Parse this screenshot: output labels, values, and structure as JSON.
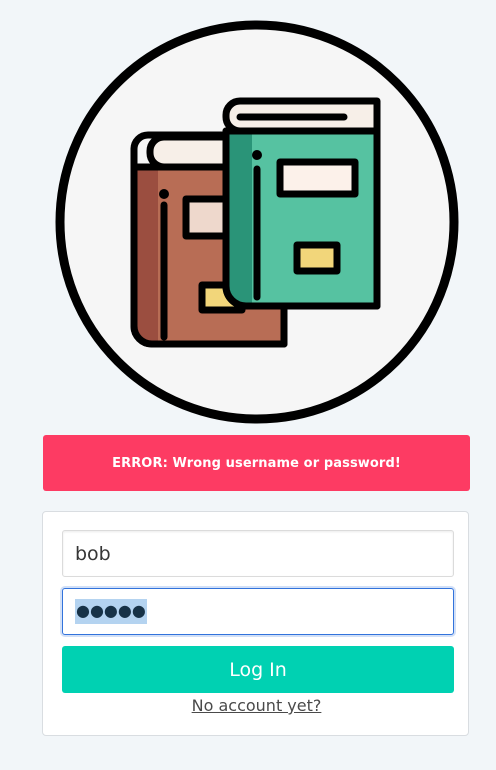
{
  "logo": {
    "icon": "books-icon",
    "colors": {
      "ring": "#000000",
      "circle_fill": "#f6f6f6",
      "brown_book": "#b86d55",
      "brown_spine": "#9b4e40",
      "green_book": "#56c2a1",
      "green_spine": "#2a9478",
      "pages": "#f7efe8",
      "label_light": "#eed8cc",
      "label_yellow": "#f2d67a"
    }
  },
  "error": {
    "message": "ERROR: Wrong username or password!",
    "color": "#fd3b63"
  },
  "form": {
    "username_value": "bob",
    "password_masked": "●●●●●",
    "login_label": "Log In",
    "login_color": "#00d1b2",
    "no_account_link": "No account yet?"
  }
}
